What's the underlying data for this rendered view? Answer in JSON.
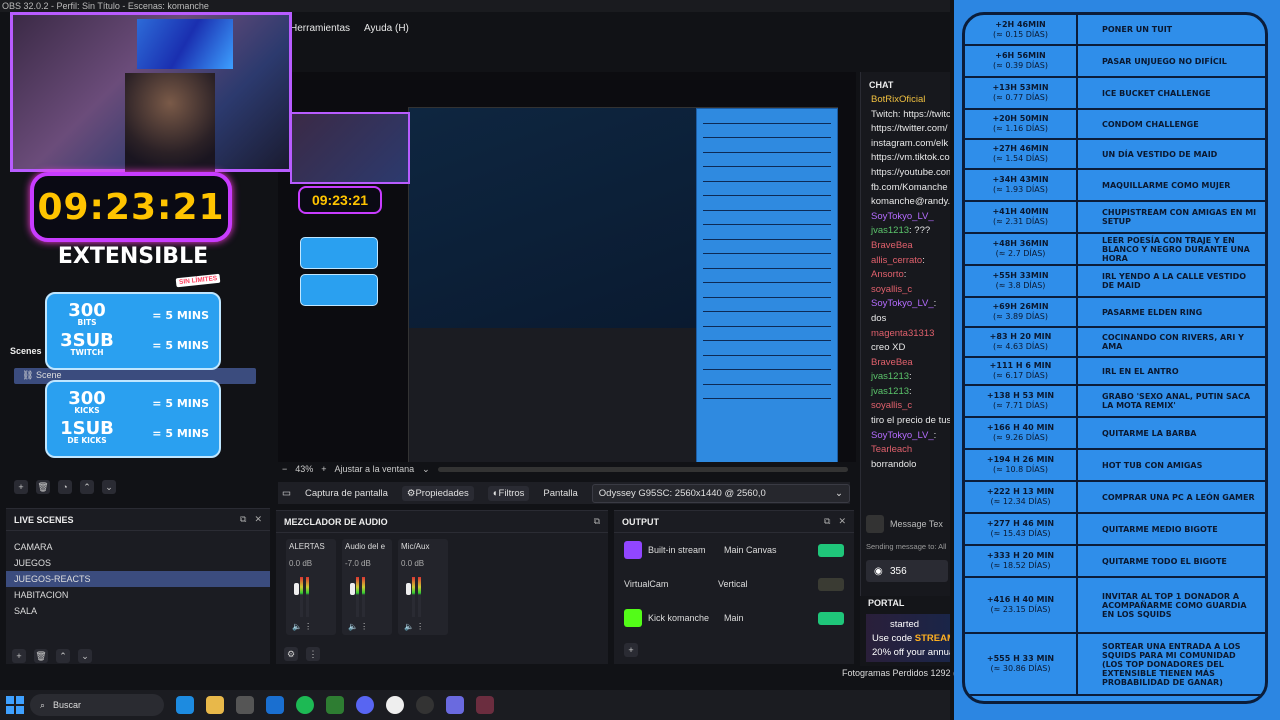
{
  "window": {
    "title": "OBS 32.0.2 - Perfil: Sin Título - Escenas: komanche"
  },
  "menu": [
    "Herramientas",
    "Ayuda (H)"
  ],
  "overlay": {
    "timer": "09:23:21",
    "extensible": "EXTENSIBLE",
    "sin_limites": "SIN LÍMITES",
    "bits_line": {
      "big": "300",
      "small": "BITS",
      "value": "= 5 MINS"
    },
    "sub_twitch_line": {
      "big": "3SUB",
      "small": "TWITCH",
      "value": "= 5 MINS"
    },
    "kicks_line": {
      "big": "300",
      "small": "KICKS",
      "value": "= 5 MINS"
    },
    "sub_kicks_line": {
      "big": "1SUB",
      "small": "DE KICKS",
      "value": "= 5 MINS"
    }
  },
  "scenes_panel": {
    "header": "Scenes",
    "items": [
      "Scene"
    ]
  },
  "preview": {
    "zoom": "43%",
    "fit": "Ajustar a la ventana",
    "minus": "−",
    "plus": "+"
  },
  "source_bar": {
    "capture": "Captura de pantalla",
    "properties": "Propiedades",
    "filters": "Filtros",
    "display_label": "Pantalla",
    "display_value": "Odyssey G95SC: 2560x1440 @ 2560,0"
  },
  "live_scenes": {
    "header": "LIVE SCENES",
    "items": [
      "CAMARA",
      "JUEGOS",
      "JUEGOS-REACTS",
      "HABITACION",
      "SALA"
    ],
    "active_index": 2
  },
  "mixer": {
    "header": "MEZCLADOR DE AUDIO",
    "channels": [
      {
        "name": "ALERTAS",
        "db": "0.0 dB"
      },
      {
        "name": "Audio del e",
        "db": "-7.0 dB"
      },
      {
        "name": "Mic/Aux",
        "db": "0.0 dB"
      }
    ]
  },
  "output": {
    "header": "OUTPUT",
    "rows": [
      {
        "name": "Built-in stream",
        "target": "Main Canvas",
        "on": true
      },
      {
        "name": "VirtualCam",
        "target": "Vertical",
        "on": false
      },
      {
        "name": "Kick komanche",
        "target": "Main",
        "on": true
      }
    ]
  },
  "chat": {
    "header": "CHAT",
    "lines": [
      {
        "user": "BotRixOficial",
        "text": "",
        "cls": "u4"
      },
      {
        "user": "",
        "text": "Twitch: https://twitch",
        "cls": ""
      },
      {
        "user": "",
        "text": "https://twitter.com/",
        "cls": ""
      },
      {
        "user": "",
        "text": "instagram.com/elk",
        "cls": ""
      },
      {
        "user": "",
        "text": "https://vm.tiktok.co",
        "cls": ""
      },
      {
        "user": "",
        "text": "https://youtube.com",
        "cls": ""
      },
      {
        "user": "",
        "text": "fb.com/Komanche",
        "cls": ""
      },
      {
        "user": "",
        "text": "komanche@randy.c",
        "cls": ""
      },
      {
        "user": "SoyTokyo_LV_",
        "text": "",
        "cls": "u1"
      },
      {
        "user": "jvas1213",
        "text": ": ???",
        "cls": "u3"
      },
      {
        "user": "BraveBea",
        "text": "",
        "cls": "u2"
      },
      {
        "user": "allis_cerrato",
        "text": ":",
        "cls": "u2"
      },
      {
        "user": "Ansorto",
        "text": ":",
        "cls": "u2"
      },
      {
        "user": "soyallis_c",
        "text": "",
        "cls": "u2"
      },
      {
        "user": "SoyTokyo_LV_",
        "text": ":",
        "cls": "u1"
      },
      {
        "user": "",
        "text": "dos",
        "cls": ""
      },
      {
        "user": "magenta31313",
        "text": "",
        "cls": "u2"
      },
      {
        "user": "",
        "text": "creo XD",
        "cls": ""
      },
      {
        "user": "BraveBea",
        "text": "",
        "cls": "u2"
      },
      {
        "user": "jvas1213",
        "text": ":",
        "cls": "u3"
      },
      {
        "user": "jvas1213",
        "text": ":",
        "cls": "u3"
      },
      {
        "user": "soyallis_c",
        "text": "",
        "cls": "u2"
      },
      {
        "user": "",
        "text": "tiro el precio de tus",
        "cls": ""
      },
      {
        "user": "SoyTokyo_LV_",
        "text": ":",
        "cls": "u1"
      },
      {
        "user": "Tearleach",
        "text": "",
        "cls": "u2"
      },
      {
        "user": "",
        "text": "borrandolo",
        "cls": ""
      }
    ],
    "input_placeholder": "Message Tex",
    "sending": "Sending message to: All",
    "viewers": "356"
  },
  "portal": {
    "header": "PORTAL",
    "ad_line1": "started",
    "ad_line2_prefix": "Use code ",
    "ad_code": "STREAM",
    "ad_line3": "20% off your annua"
  },
  "status": {
    "frames_dropped": "Fotogramas Perdidos 1292 (0"
  },
  "taskbar": {
    "search": "Buscar"
  },
  "rules": [
    {
      "time": "+2H 46MIN",
      "days": "(≈ 0.15 DÍAS)",
      "action": "PONER UN TUIT"
    },
    {
      "time": "+6H 56MIN",
      "days": "(≈ 0.39 DÍAS)",
      "action": "PASAR UNJUEGO NO DIFÍCIL"
    },
    {
      "time": "+13H 53MIN",
      "days": "(≈ 0.77 DÍAS)",
      "action": "ICE BUCKET CHALLENGE"
    },
    {
      "time": "+20H 50MIN",
      "days": "(≈ 1.16 DÍAS)",
      "action": "CONDOM CHALLENGE"
    },
    {
      "time": "+27H 46MIN",
      "days": "(≈ 1.54 DÍAS)",
      "action": "UN DÍA VESTIDO DE MAID"
    },
    {
      "time": "+34H 43MIN",
      "days": "(≈ 1.93 DÍAS)",
      "action": "MAQUILLARME COMO MUJER"
    },
    {
      "time": "+41H 40MIN",
      "days": "(≈ 2.31 DÍAS)",
      "action": "CHUPISTREAM CON AMIGAS EN MI SETUP"
    },
    {
      "time": "+48H 36MIN",
      "days": "(≈ 2.7 DÍAS)",
      "action": "LEER POESÍA CON TRAJE Y EN BLANCO Y NEGRO DURANTE UNA HORA"
    },
    {
      "time": "+55H 33MIN",
      "days": "(≈ 3.8 DÍAS)",
      "action": "IRL YENDO A LA CALLE VESTIDO DE MAID"
    },
    {
      "time": "+69H 26MIN",
      "days": "(≈ 3.89 DÍAS)",
      "action": "PASARME ELDEN RING"
    },
    {
      "time": "+83 H 20 MIN",
      "days": "(≈ 4.63 DÍAS)",
      "action": "COCINANDO CON RIVERS, ARI Y AMA"
    },
    {
      "time": "+111 H 6 MIN",
      "days": "(≈ 6.17 DÍAS)",
      "action": "IRL EN EL ANTRO"
    },
    {
      "time": "+138 H 53 MIN",
      "days": "(≈ 7.71 DÍAS)",
      "action": "GRABO 'SEXO ANAL, PUTIN SACA LA MOTA REMIX'"
    },
    {
      "time": "+166 H 40 MIN",
      "days": "(≈ 9.26 DÍAS)",
      "action": "QUITARME LA BARBA"
    },
    {
      "time": "+194 H 26 MIN",
      "days": "(≈ 10.8 DÍAS)",
      "action": "HOT TUB CON AMIGAS"
    },
    {
      "time": "+222 H 13 MIN",
      "days": "(≈ 12.34 DÍAS)",
      "action": "COMPRAR UNA PC A LEÓN GAMER"
    },
    {
      "time": "+277 H 46 MIN",
      "days": "(≈ 15.43 DÍAS)",
      "action": "QUITARME MEDIO BIGOTE"
    },
    {
      "time": "+333 H 20 MIN",
      "days": "(≈ 18.52 DÍAS)",
      "action": "QUITARME TODO EL BIGOTE"
    },
    {
      "time": "+416 H 40 MIN",
      "days": "(≈ 23.15 DÍAS)",
      "action": "INVITAR AL TOP 1 DONADOR A ACOMPAÑARME COMO GUARDIA EN LOS SQUIDS"
    },
    {
      "time": "+555 H 33 MIN",
      "days": "(≈ 30.86 DÍAS)",
      "action": "SORTEAR UNA ENTRADA A LOS SQUIDS PARA MI COMUNIDAD (LOS TOP DONADORES DEL EXTENSIBLE TIENEN MÁS PROBABILIDAD DE GANAR)"
    }
  ],
  "colors": {
    "accent": "#3b4c7e",
    "timer": "#ffc400",
    "rules_bg": "#2f8eea",
    "toggle_on": "#1fc67a"
  }
}
